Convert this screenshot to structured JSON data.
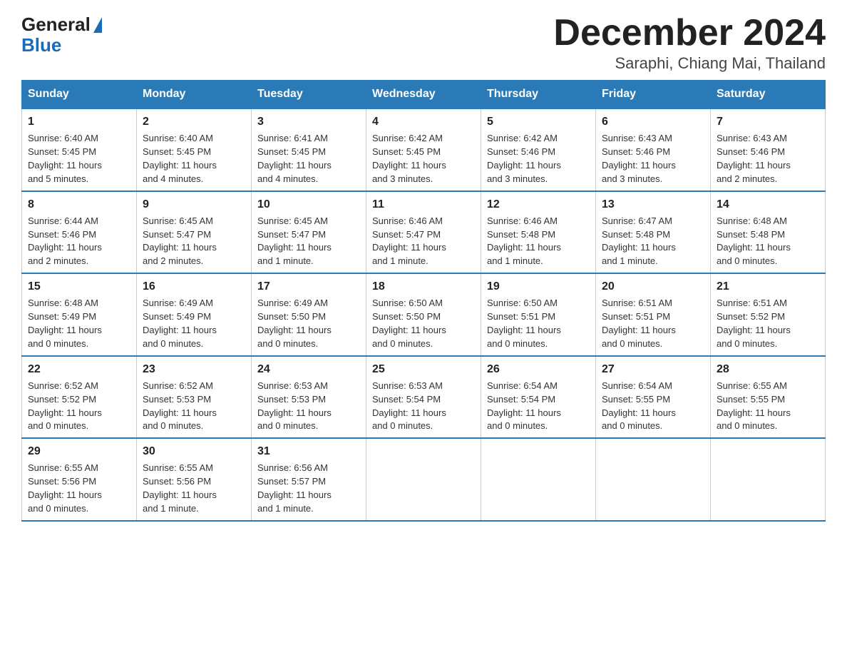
{
  "header": {
    "month_title": "December 2024",
    "location": "Saraphi, Chiang Mai, Thailand",
    "logo_general": "General",
    "logo_blue": "Blue"
  },
  "days_of_week": [
    "Sunday",
    "Monday",
    "Tuesday",
    "Wednesday",
    "Thursday",
    "Friday",
    "Saturday"
  ],
  "weeks": [
    [
      {
        "date": "1",
        "sunrise": "6:40 AM",
        "sunset": "5:45 PM",
        "daylight": "11 hours and 5 minutes."
      },
      {
        "date": "2",
        "sunrise": "6:40 AM",
        "sunset": "5:45 PM",
        "daylight": "11 hours and 4 minutes."
      },
      {
        "date": "3",
        "sunrise": "6:41 AM",
        "sunset": "5:45 PM",
        "daylight": "11 hours and 4 minutes."
      },
      {
        "date": "4",
        "sunrise": "6:42 AM",
        "sunset": "5:45 PM",
        "daylight": "11 hours and 3 minutes."
      },
      {
        "date": "5",
        "sunrise": "6:42 AM",
        "sunset": "5:46 PM",
        "daylight": "11 hours and 3 minutes."
      },
      {
        "date": "6",
        "sunrise": "6:43 AM",
        "sunset": "5:46 PM",
        "daylight": "11 hours and 3 minutes."
      },
      {
        "date": "7",
        "sunrise": "6:43 AM",
        "sunset": "5:46 PM",
        "daylight": "11 hours and 2 minutes."
      }
    ],
    [
      {
        "date": "8",
        "sunrise": "6:44 AM",
        "sunset": "5:46 PM",
        "daylight": "11 hours and 2 minutes."
      },
      {
        "date": "9",
        "sunrise": "6:45 AM",
        "sunset": "5:47 PM",
        "daylight": "11 hours and 2 minutes."
      },
      {
        "date": "10",
        "sunrise": "6:45 AM",
        "sunset": "5:47 PM",
        "daylight": "11 hours and 1 minute."
      },
      {
        "date": "11",
        "sunrise": "6:46 AM",
        "sunset": "5:47 PM",
        "daylight": "11 hours and 1 minute."
      },
      {
        "date": "12",
        "sunrise": "6:46 AM",
        "sunset": "5:48 PM",
        "daylight": "11 hours and 1 minute."
      },
      {
        "date": "13",
        "sunrise": "6:47 AM",
        "sunset": "5:48 PM",
        "daylight": "11 hours and 1 minute."
      },
      {
        "date": "14",
        "sunrise": "6:48 AM",
        "sunset": "5:48 PM",
        "daylight": "11 hours and 0 minutes."
      }
    ],
    [
      {
        "date": "15",
        "sunrise": "6:48 AM",
        "sunset": "5:49 PM",
        "daylight": "11 hours and 0 minutes."
      },
      {
        "date": "16",
        "sunrise": "6:49 AM",
        "sunset": "5:49 PM",
        "daylight": "11 hours and 0 minutes."
      },
      {
        "date": "17",
        "sunrise": "6:49 AM",
        "sunset": "5:50 PM",
        "daylight": "11 hours and 0 minutes."
      },
      {
        "date": "18",
        "sunrise": "6:50 AM",
        "sunset": "5:50 PM",
        "daylight": "11 hours and 0 minutes."
      },
      {
        "date": "19",
        "sunrise": "6:50 AM",
        "sunset": "5:51 PM",
        "daylight": "11 hours and 0 minutes."
      },
      {
        "date": "20",
        "sunrise": "6:51 AM",
        "sunset": "5:51 PM",
        "daylight": "11 hours and 0 minutes."
      },
      {
        "date": "21",
        "sunrise": "6:51 AM",
        "sunset": "5:52 PM",
        "daylight": "11 hours and 0 minutes."
      }
    ],
    [
      {
        "date": "22",
        "sunrise": "6:52 AM",
        "sunset": "5:52 PM",
        "daylight": "11 hours and 0 minutes."
      },
      {
        "date": "23",
        "sunrise": "6:52 AM",
        "sunset": "5:53 PM",
        "daylight": "11 hours and 0 minutes."
      },
      {
        "date": "24",
        "sunrise": "6:53 AM",
        "sunset": "5:53 PM",
        "daylight": "11 hours and 0 minutes."
      },
      {
        "date": "25",
        "sunrise": "6:53 AM",
        "sunset": "5:54 PM",
        "daylight": "11 hours and 0 minutes."
      },
      {
        "date": "26",
        "sunrise": "6:54 AM",
        "sunset": "5:54 PM",
        "daylight": "11 hours and 0 minutes."
      },
      {
        "date": "27",
        "sunrise": "6:54 AM",
        "sunset": "5:55 PM",
        "daylight": "11 hours and 0 minutes."
      },
      {
        "date": "28",
        "sunrise": "6:55 AM",
        "sunset": "5:55 PM",
        "daylight": "11 hours and 0 minutes."
      }
    ],
    [
      {
        "date": "29",
        "sunrise": "6:55 AM",
        "sunset": "5:56 PM",
        "daylight": "11 hours and 0 minutes."
      },
      {
        "date": "30",
        "sunrise": "6:55 AM",
        "sunset": "5:56 PM",
        "daylight": "11 hours and 1 minute."
      },
      {
        "date": "31",
        "sunrise": "6:56 AM",
        "sunset": "5:57 PM",
        "daylight": "11 hours and 1 minute."
      },
      {
        "date": "",
        "sunrise": "",
        "sunset": "",
        "daylight": ""
      },
      {
        "date": "",
        "sunrise": "",
        "sunset": "",
        "daylight": ""
      },
      {
        "date": "",
        "sunrise": "",
        "sunset": "",
        "daylight": ""
      },
      {
        "date": "",
        "sunrise": "",
        "sunset": "",
        "daylight": ""
      }
    ]
  ],
  "labels": {
    "sunrise_prefix": "Sunrise: ",
    "sunset_prefix": "Sunset: ",
    "daylight_prefix": "Daylight: "
  }
}
